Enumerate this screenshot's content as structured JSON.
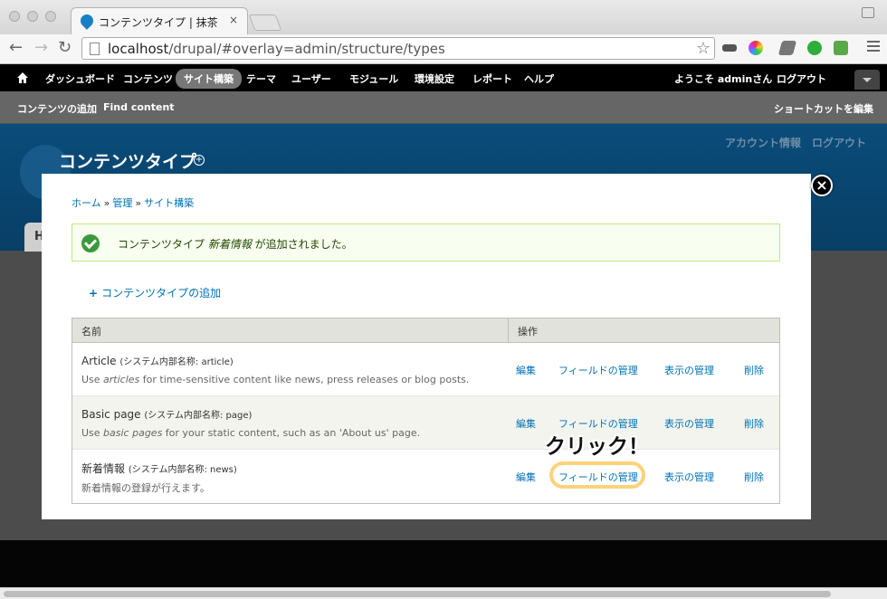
{
  "browser": {
    "tab_title": "コンテンツタイプ | 抹茶",
    "tab_close": "×",
    "url_host": "localhost",
    "url_path": "/drupal/#overlay=admin/structure/types"
  },
  "admin_bar": {
    "items": [
      "ダッシュボード",
      "コンテンツ",
      "サイト構築",
      "テーマ",
      "ユーザー",
      "モジュール",
      "環境設定",
      "レポート",
      "ヘルプ"
    ],
    "welcome": "ようこそ adminさん",
    "logout": "ログアウト"
  },
  "shortcut_bar": {
    "items": [
      "コンテンツの追加",
      "Find content"
    ],
    "edit": "ショートカットを編集"
  },
  "background_page": {
    "title": "コンテンツタイプ",
    "account": "アカウント情報",
    "logout": "ログアウト",
    "tab_letter": "H"
  },
  "overlay": {
    "close": "×",
    "breadcrumb": [
      "ホーム",
      "管理",
      "サイト構築"
    ],
    "breadcrumb_sep": "»",
    "status": {
      "prefix": "コンテンツタイプ ",
      "name": "新着情報",
      "suffix": " が追加されました。"
    },
    "add_link": "コンテンツタイプの追加",
    "add_icon": "+",
    "table": {
      "headers": [
        "名前",
        "操作"
      ],
      "rows": [
        {
          "name": "Article",
          "machine": "(システム内部名称: article)",
          "desc_pre": "Use ",
          "desc_em": "articles",
          "desc_post": " for time-sensitive content like news, press releases or blog posts.",
          "ops": [
            "編集",
            "フィールドの管理",
            "表示の管理",
            "削除"
          ]
        },
        {
          "name": "Basic page",
          "machine": "(システム内部名称: page)",
          "desc_pre": "Use ",
          "desc_em": "basic pages",
          "desc_post": " for your static content, such as an 'About us' page.",
          "ops": [
            "編集",
            "フィールドの管理",
            "表示の管理",
            "削除"
          ]
        },
        {
          "name": "新着情報",
          "machine": "(システム内部名称: news)",
          "desc_pre": "新着情報の登録が行えます。",
          "desc_em": "",
          "desc_post": "",
          "ops": [
            "編集",
            "フィールドの管理",
            "表示の管理",
            "削除"
          ]
        }
      ]
    },
    "annotation": "クリック！"
  },
  "colors": {
    "admin_bar": "#000000",
    "link": "#0071b3",
    "highlight": "#fcd37a",
    "status_bg": "#f8fff0"
  }
}
